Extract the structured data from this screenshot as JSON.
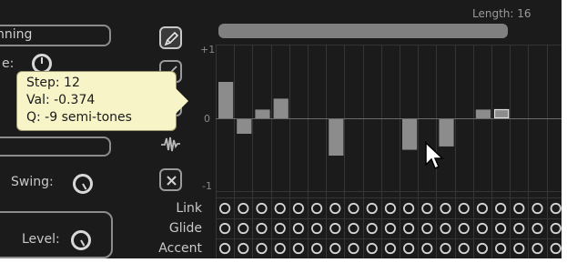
{
  "length_label": "Length: 16",
  "axis": {
    "top": "+1",
    "zero": "0",
    "bottom": "-1"
  },
  "left_panel": {
    "preset_field": "nning",
    "cutoff_label": "e:",
    "swing_label": "Swing:",
    "level_label": "Level:"
  },
  "tools": [
    {
      "name": "pencil-tool-button",
      "icon": "pencil-icon",
      "active": true
    },
    {
      "name": "line-tool-button",
      "icon": "line-icon",
      "active": false
    },
    {
      "name": "flat-tool-button",
      "icon": "flat-icon",
      "active": false
    },
    {
      "name": "randomize-tool-button",
      "icon": "wave-icon",
      "active": false
    },
    {
      "name": "clear-tool-button",
      "icon": "close-icon",
      "active": false
    }
  ],
  "tooltip": {
    "step": "Step: 12",
    "val": "Val: -0.374",
    "q": "Q: -9 semi-tones"
  },
  "rows": {
    "link": "Link",
    "glide": "Glide",
    "accent": "Accent"
  },
  "steps": {
    "count": 19,
    "values": [
      0.5,
      -0.2,
      0.12,
      0.27,
      0,
      0,
      -0.5,
      0,
      0,
      0,
      -0.42,
      0,
      -0.374,
      0,
      0.12,
      0.12,
      0,
      0,
      0
    ],
    "highlighted_step": 15
  },
  "colors": {
    "panel_bg": "#1b1b1b",
    "bar": "#8c8c8c",
    "grid": "#353535",
    "tooltip_bg": "#f7f4c8"
  }
}
